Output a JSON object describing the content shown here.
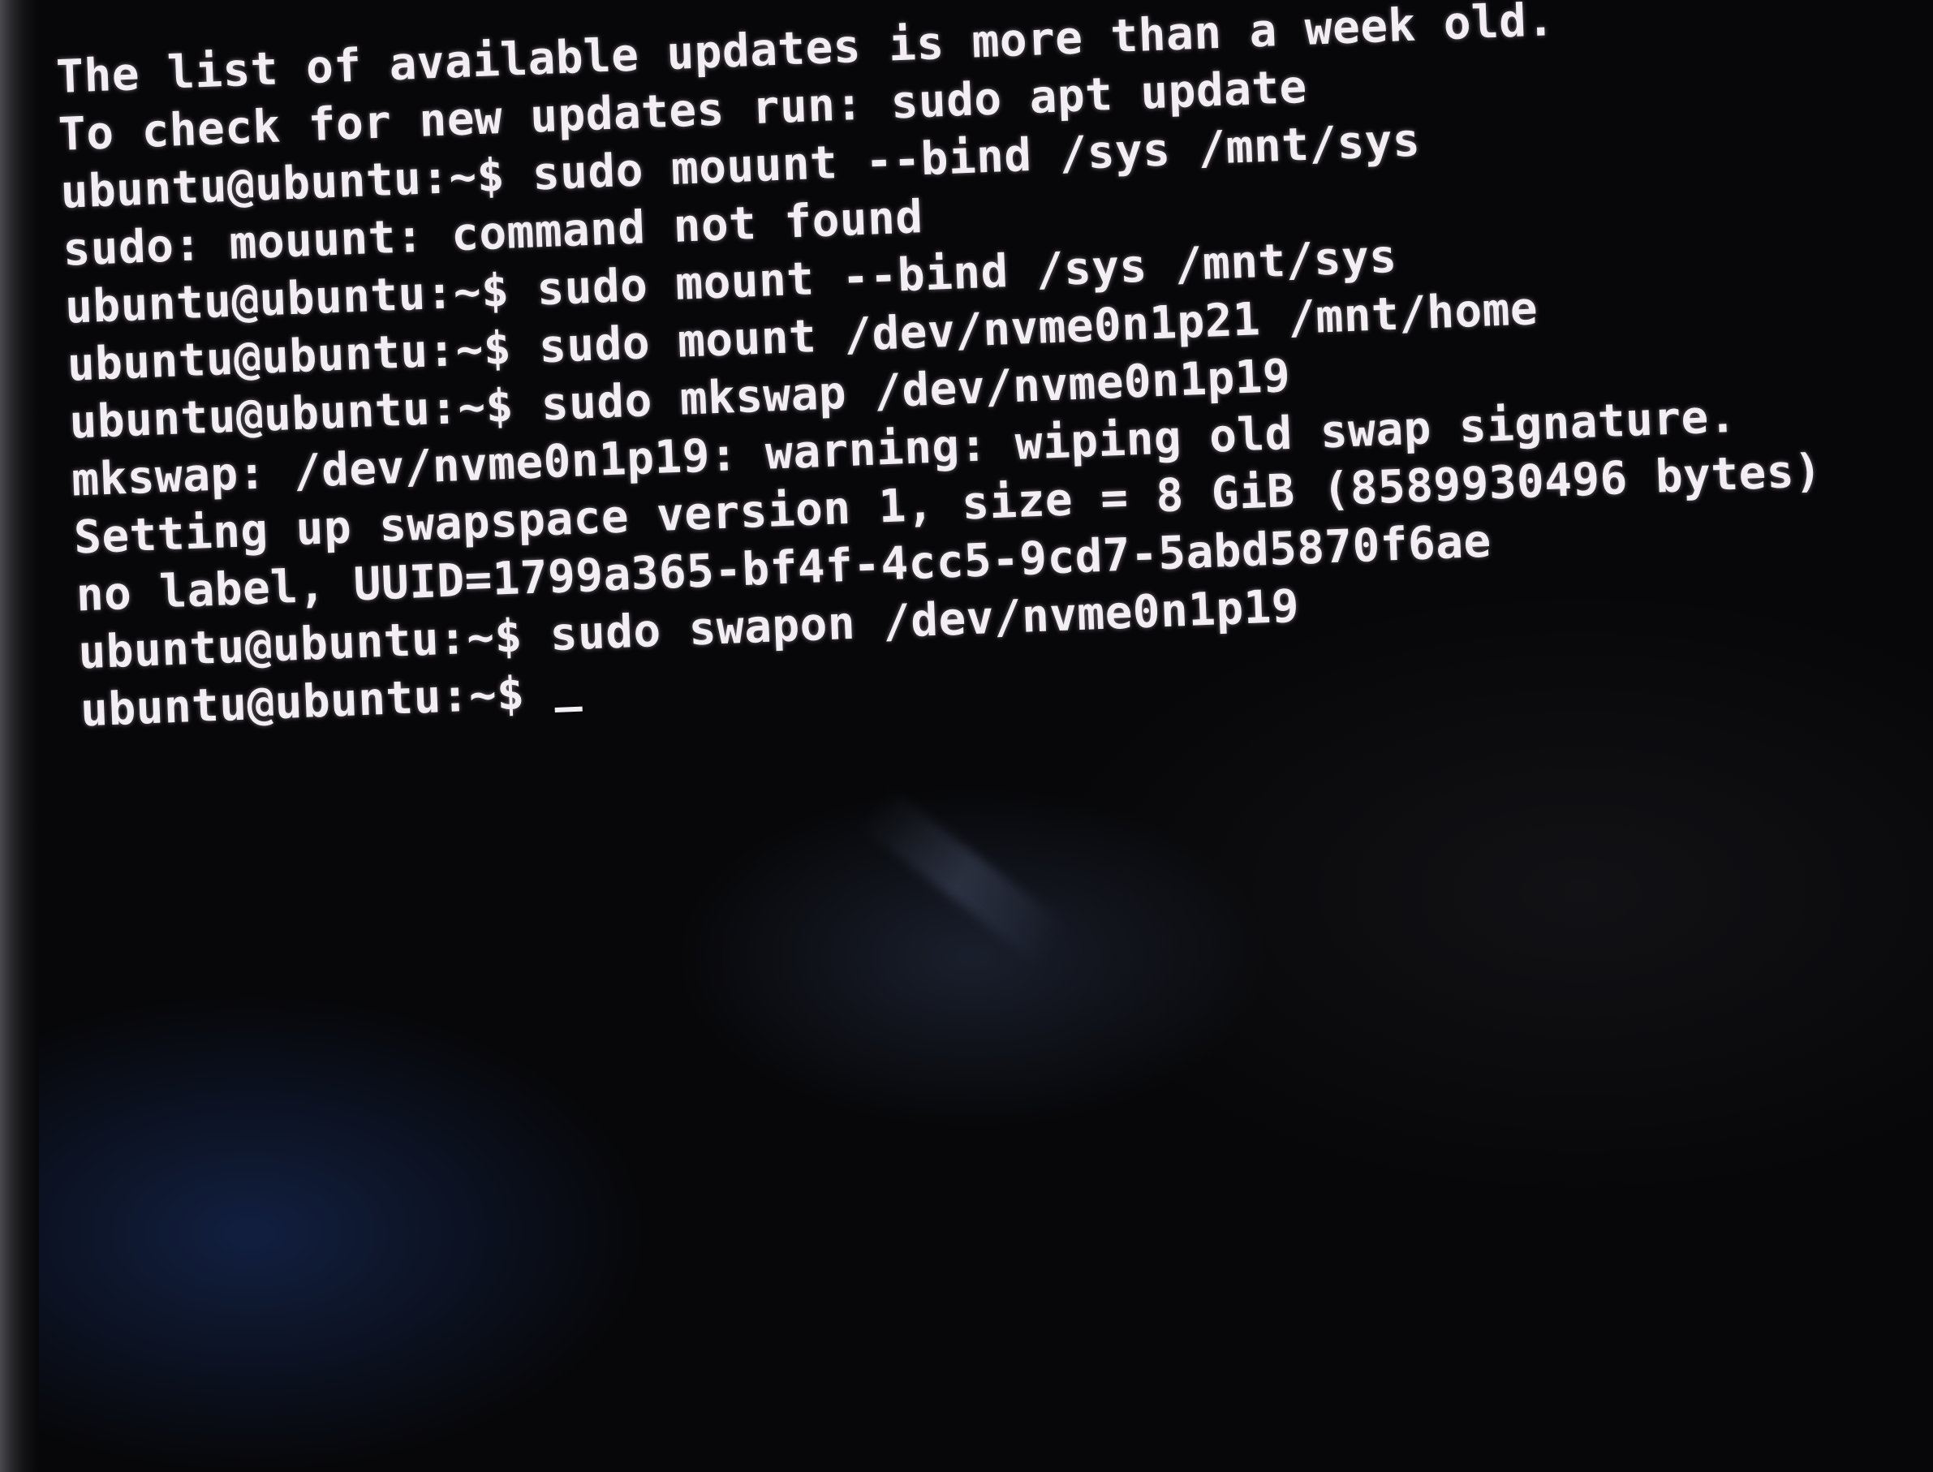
{
  "terminal": {
    "lines": [
      "The list of available updates is more than a week old.",
      "To check for new updates run: sudo apt update",
      "ubuntu@ubuntu:~$ sudo mouunt --bind /sys /mnt/sys",
      "sudo: mouunt: command not found",
      "ubuntu@ubuntu:~$ sudo mount --bind /sys /mnt/sys",
      "ubuntu@ubuntu:~$ sudo mount /dev/nvme0n1p21 /mnt/home",
      "ubuntu@ubuntu:~$ sudo mkswap /dev/nvme0n1p19",
      "mkswap: /dev/nvme0n1p19: warning: wiping old swap signature.",
      "Setting up swapspace version 1, size = 8 GiB (8589930496 bytes)",
      "no label, UUID=1799a365-bf4f-4cc5-9cd7-5abd5870f6ae",
      "ubuntu@ubuntu:~$ sudo swapon /dev/nvme0n1p19"
    ],
    "prompt": "ubuntu@ubuntu:~$ ",
    "text_color": "#f2eef4",
    "background_color": "#070709"
  }
}
